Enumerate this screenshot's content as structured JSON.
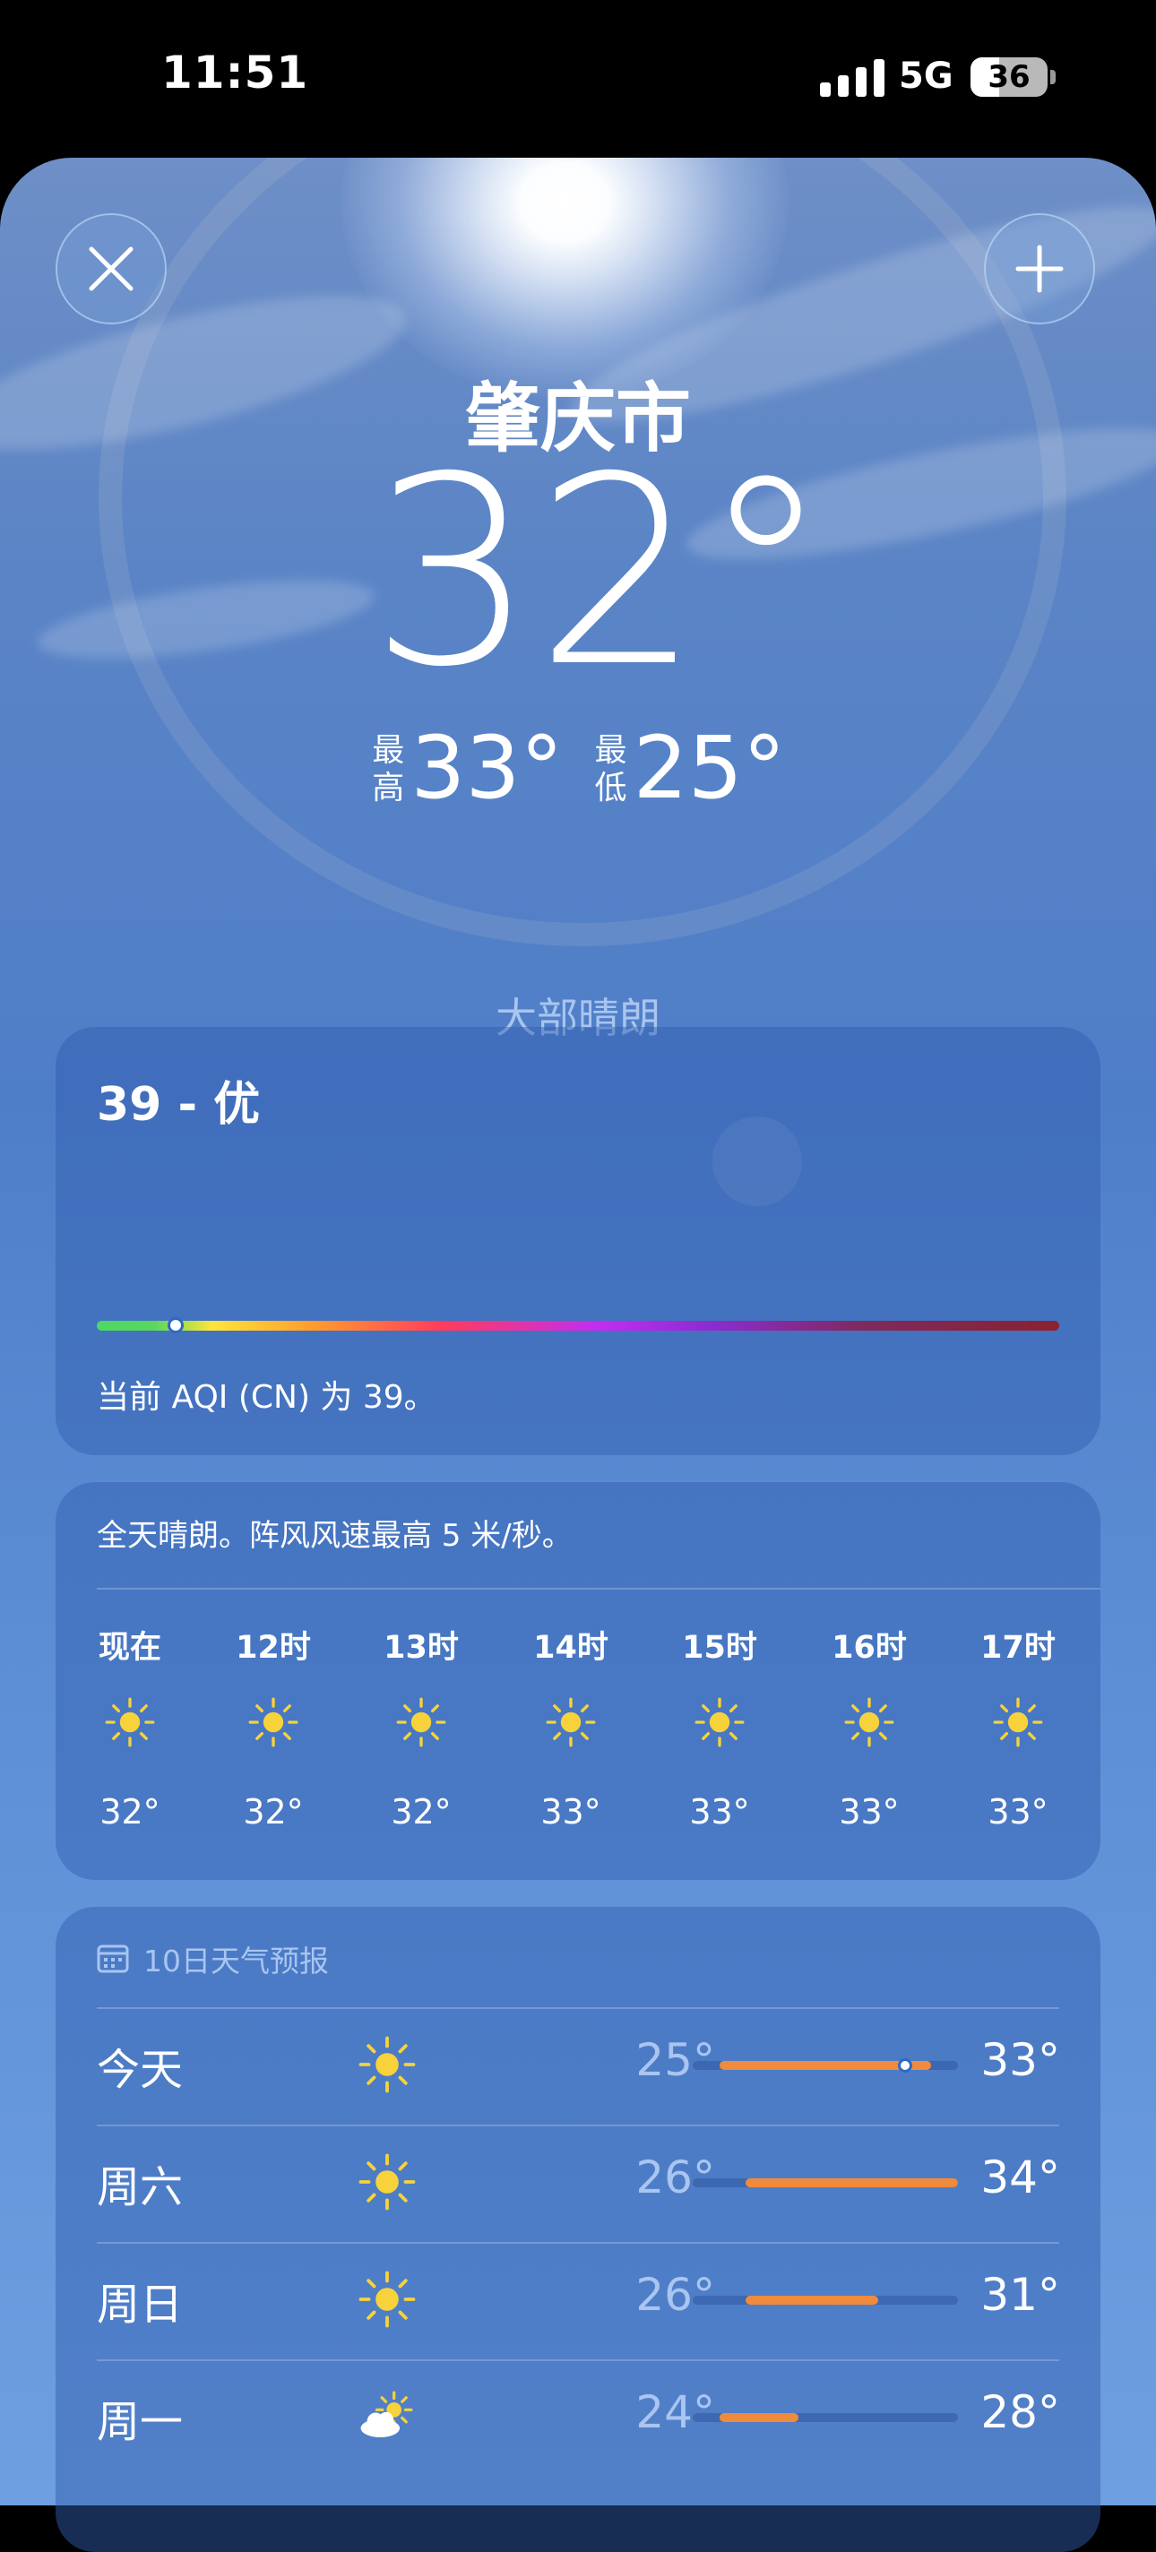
{
  "status_bar": {
    "time": "11:51",
    "network": "5G",
    "battery": "36"
  },
  "location": {
    "city": "肇庆市",
    "temperature": "32°",
    "high_label": "最高",
    "high": "33°",
    "low_label": "最低",
    "low": "25°",
    "condition": "大部晴朗"
  },
  "aqi": {
    "title": "39 - 优",
    "description": "当前 AQI (CN) 为 39。",
    "level_fraction": 0.08
  },
  "hourly": {
    "summary": "全天晴朗。阵风风速最高 5 米/秒。",
    "items": [
      {
        "label": "现在",
        "icon": "sun-icon",
        "temp": "32°"
      },
      {
        "label": "12时",
        "icon": "sun-icon",
        "temp": "32°"
      },
      {
        "label": "13时",
        "icon": "sun-icon",
        "temp": "32°"
      },
      {
        "label": "14时",
        "icon": "sun-icon",
        "temp": "33°"
      },
      {
        "label": "15时",
        "icon": "sun-icon",
        "temp": "33°"
      },
      {
        "label": "16时",
        "icon": "sun-icon",
        "temp": "33°"
      },
      {
        "label": "17时",
        "icon": "sun-icon",
        "temp": "33°"
      }
    ]
  },
  "ten_day": {
    "header": "10日天气预报",
    "range_min": 24,
    "range_max": 34,
    "days": [
      {
        "name": "今天",
        "icon": "sun-icon",
        "low": "25°",
        "high": "33°",
        "low_val": 25,
        "high_val": 33,
        "current": 32
      },
      {
        "name": "周六",
        "icon": "sun-icon",
        "low": "26°",
        "high": "34°",
        "low_val": 26,
        "high_val": 34
      },
      {
        "name": "周日",
        "icon": "sun-icon",
        "low": "26°",
        "high": "31°",
        "low_val": 26,
        "high_val": 31
      },
      {
        "name": "周一",
        "icon": "partly-cloudy-icon",
        "low": "24°",
        "high": "28°",
        "low_val": 25,
        "high_val": 28
      }
    ]
  },
  "colors": {
    "accent_secondary_text": "#a9c5f0",
    "temp_bar": "#f08a3c",
    "sun_icon": "#f7d23a"
  }
}
